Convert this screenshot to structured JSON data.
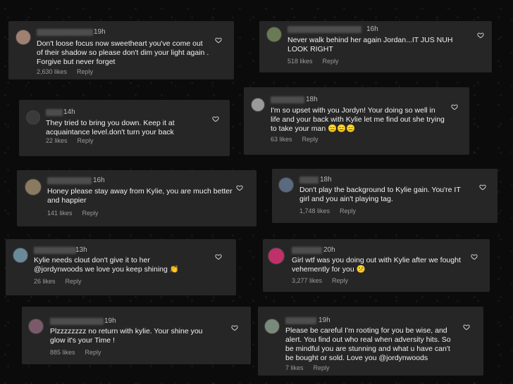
{
  "comments": [
    {
      "time": "19h",
      "text": "Don't loose focus now sweetheart you've come out of their shadow so please don't dim your light again . Forgive but never forget",
      "likes": "2,630 likes",
      "reply": "Reply",
      "avatar_color": "#a08070"
    },
    {
      "time": "16h",
      "text": "Never walk behind her again Jordan...IT JUS NUH LOOK RIGHT",
      "likes": "518 likes",
      "reply": "Reply",
      "avatar_color": "#6a7a55"
    },
    {
      "time": "14h",
      "text": "They tried to bring you down. Keep it at acquaintance level.don't turn your back",
      "likes": "22 likes",
      "reply": "Reply",
      "avatar_color": "#3a3a3a"
    },
    {
      "time": "18h",
      "text": "I'm so upset with you Jordyn! Your doing so well in life and your back with Kylie let me find out she trying to take your man 😑😑😑",
      "likes": "63 likes",
      "reply": "Reply",
      "avatar_color": "#9a9a9a"
    },
    {
      "time": "16h",
      "text": "Honey please stay away from Kylie, you are much better and happier",
      "likes": "141 likes",
      "reply": "Reply",
      "avatar_color": "#8a7a60"
    },
    {
      "time": "18h",
      "text": "Don't play the background to Kylie gain. You're IT girl and you ain't playing tag.",
      "likes": "1,748 likes",
      "reply": "Reply",
      "avatar_color": "#5a6a80"
    },
    {
      "time": "13h",
      "text": "Kylie needs clout don't give it to her @jordynwoods  we love you keep shining 👏",
      "likes": "26 likes",
      "reply": "Reply",
      "avatar_color": "#6a8a9a"
    },
    {
      "time": "20h",
      "text": "Girl wtf was you doing out with Kylie after we fought vehemently for you 😕",
      "likes": "3,277 likes",
      "reply": "Reply",
      "avatar_color": "#c0306a"
    },
    {
      "time": "19h",
      "text": "Plzzzzzzzz no return with kylie. Your shine you glow it's your Time !",
      "likes": "885 likes",
      "reply": "Reply",
      "avatar_color": "#7a5a6a"
    },
    {
      "time": "19h",
      "text": "Please be careful I'm rooting for you be wise, and alert. You find out who real when adversity hits. So be mindful you are stunning and what u have can't be bought or sold. Love you @jordynwoods",
      "likes": "7 likes",
      "reply": "Reply",
      "avatar_color": "#7a8a7a"
    }
  ],
  "icons": {
    "like": "heart-icon"
  }
}
